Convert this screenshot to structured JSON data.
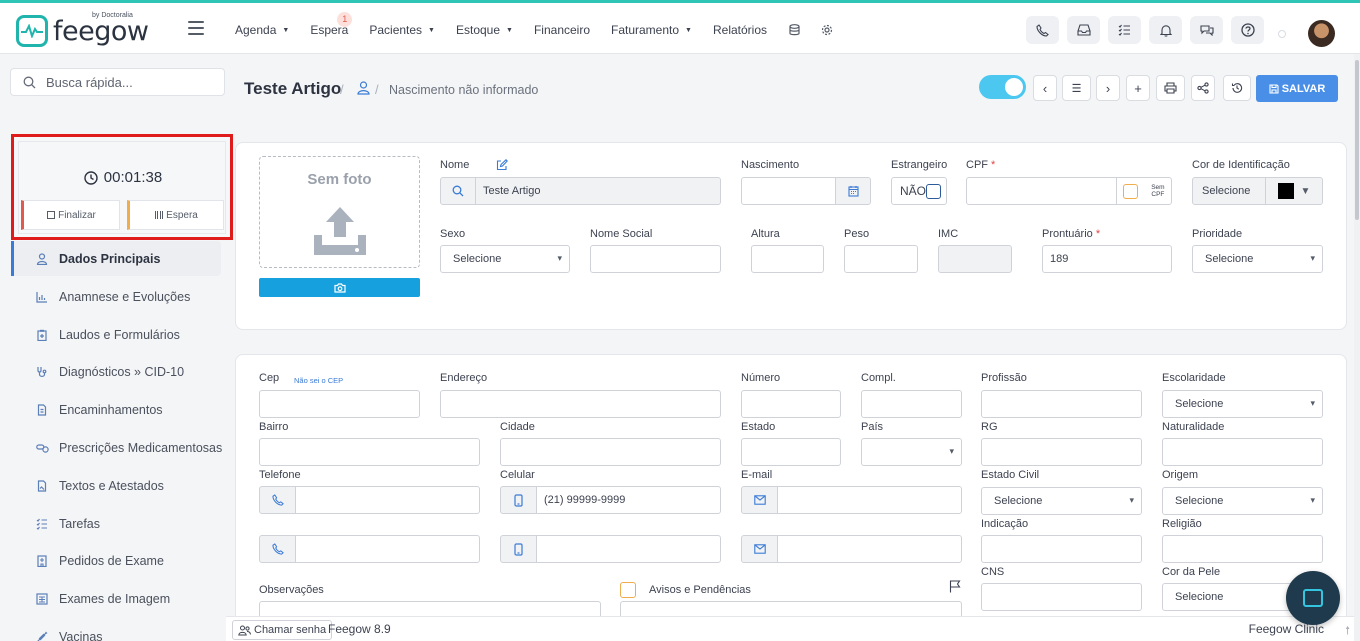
{
  "brand": {
    "name": "feegow",
    "sub": "by Doctoralia"
  },
  "nav": {
    "items": [
      {
        "label": "Agenda",
        "caret": true
      },
      {
        "label": "Espera",
        "badge": "1"
      },
      {
        "label": "Pacientes",
        "caret": true
      },
      {
        "label": "Estoque",
        "caret": true
      },
      {
        "label": "Financeiro"
      },
      {
        "label": "Faturamento",
        "caret": true
      },
      {
        "label": "Relatórios"
      }
    ]
  },
  "search": {
    "placeholder": "Busca rápida..."
  },
  "timer": {
    "value": "00:01:38",
    "finalizar": "Finalizar",
    "espera": "Espera"
  },
  "sidebar": {
    "items": [
      {
        "label": "Dados Principais",
        "icon": "user-icon"
      },
      {
        "label": "Anamnese e Evoluções",
        "icon": "chart-icon"
      },
      {
        "label": "Laudos e Formulários",
        "icon": "clipboard-icon"
      },
      {
        "label": "Diagnósticos » CID-10",
        "icon": "stethoscope-icon"
      },
      {
        "label": "Encaminhamentos",
        "icon": "file-icon"
      },
      {
        "label": "Prescrições Medicamentosas",
        "icon": "pills-icon"
      },
      {
        "label": "Textos e Atestados",
        "icon": "document-icon"
      },
      {
        "label": "Tarefas",
        "icon": "tasks-icon"
      },
      {
        "label": "Pedidos de Exame",
        "icon": "hospital-icon"
      },
      {
        "label": "Exames de Imagem",
        "icon": "image-icon"
      },
      {
        "label": "Vacinas",
        "icon": "syringe-icon"
      }
    ]
  },
  "patient": {
    "name": "Teste Artigo",
    "birth": "Nascimento não informado"
  },
  "actions": {
    "save": "SALVAR"
  },
  "form": {
    "photo": "Sem foto",
    "nome": {
      "label": "Nome",
      "value": "Teste Artigo"
    },
    "nascimento": {
      "label": "Nascimento"
    },
    "estrangeiro": {
      "label": "Estrangeiro",
      "value": "NÃO"
    },
    "cpf": {
      "label": "CPF",
      "sem": "Sem",
      "cpf": "CPF"
    },
    "cor": {
      "label": "Cor de Identificação",
      "value": "Selecione",
      "swatch": "#000000"
    },
    "sexo": {
      "label": "Sexo",
      "value": "Selecione"
    },
    "nome_social": {
      "label": "Nome Social"
    },
    "altura": {
      "label": "Altura"
    },
    "peso": {
      "label": "Peso"
    },
    "imc": {
      "label": "IMC"
    },
    "prontuario": {
      "label": "Prontuário",
      "value": "189"
    },
    "prioridade": {
      "label": "Prioridade",
      "value": "Selecione"
    },
    "cep": {
      "label": "Cep",
      "link": "Não sei o CEP"
    },
    "endereco": {
      "label": "Endereço"
    },
    "numero": {
      "label": "Número"
    },
    "compl": {
      "label": "Compl."
    },
    "profissao": {
      "label": "Profissão"
    },
    "escolaridade": {
      "label": "Escolaridade",
      "value": "Selecione"
    },
    "bairro": {
      "label": "Bairro"
    },
    "cidade": {
      "label": "Cidade"
    },
    "estado": {
      "label": "Estado"
    },
    "pais": {
      "label": "País"
    },
    "rg": {
      "label": "RG"
    },
    "naturalidade": {
      "label": "Naturalidade"
    },
    "telefone": {
      "label": "Telefone"
    },
    "celular": {
      "label": "Celular",
      "placeholder": "(21) 99999-9999"
    },
    "email": {
      "label": "E-mail"
    },
    "estado_civil": {
      "label": "Estado Civil",
      "value": "Selecione"
    },
    "origem": {
      "label": "Origem",
      "value": "Selecione"
    },
    "indicacao": {
      "label": "Indicação"
    },
    "religiao": {
      "label": "Religião"
    },
    "observacoes": {
      "label": "Observações"
    },
    "avisos": {
      "label": "Avisos e Pendências"
    },
    "cns": {
      "label": "CNS"
    },
    "cor_pele": {
      "label": "Cor da Pele",
      "value": "Selecione"
    }
  },
  "footer": {
    "chamar": "Chamar senha",
    "version": "Feegow 8.9",
    "clinic": "Feegow Clinic"
  },
  "colors": {
    "accent": "#4a8fe7",
    "brand": "#1fb5ad",
    "highlight": "#e01b1b"
  }
}
